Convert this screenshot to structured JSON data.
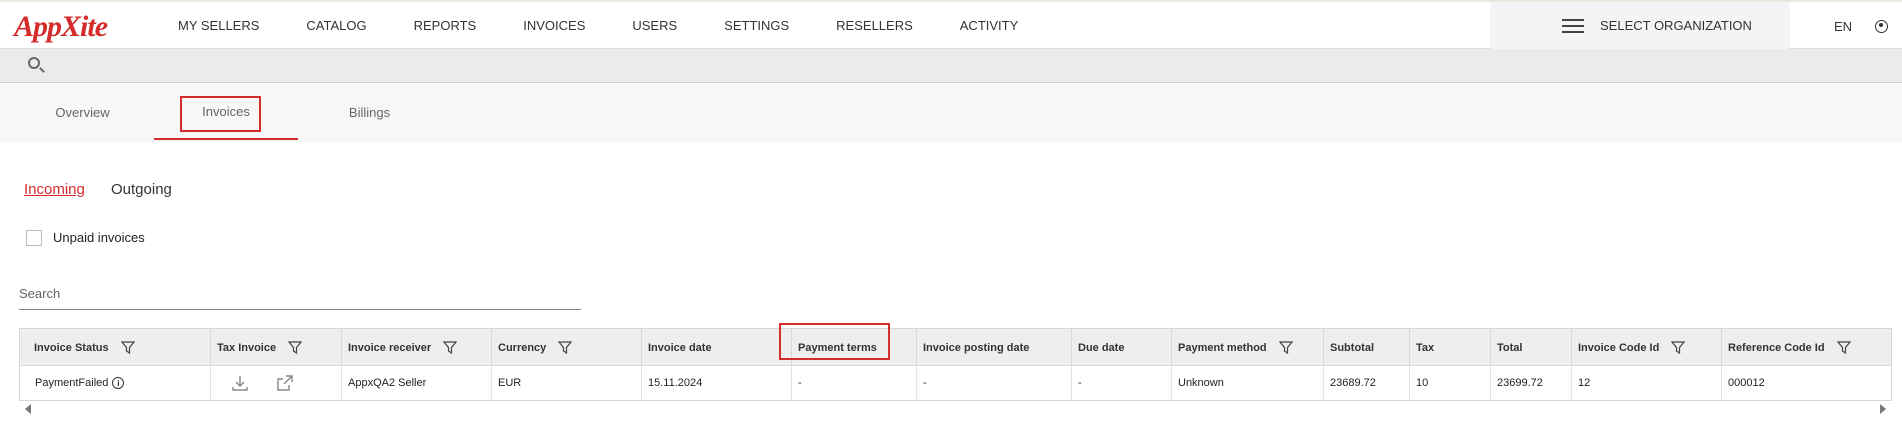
{
  "brand": {
    "logo": "AppXite",
    "accent": "#d42b2b"
  },
  "nav": [
    "MY SELLERS",
    "CATALOG",
    "REPORTS",
    "INVOICES",
    "USERS",
    "SETTINGS",
    "RESELLERS",
    "ACTIVITY"
  ],
  "org": {
    "label": "SELECT ORGANIZATION",
    "icon": "hamburger-icon"
  },
  "lang": "EN",
  "tabs": [
    {
      "label": "Overview",
      "active": false
    },
    {
      "label": "Invoices",
      "active": true
    },
    {
      "label": "Billings",
      "active": false
    }
  ],
  "subtabs": {
    "incoming": "Incoming",
    "outgoing": "Outgoing"
  },
  "filters": {
    "unpaid_label": "Unpaid invoices",
    "unpaid_checked": false
  },
  "search": {
    "placeholder": "Search"
  },
  "table": {
    "columns": [
      "Invoice Status",
      "Tax Invoice",
      "Invoice receiver",
      "Currency",
      "Invoice date",
      "Payment terms",
      "Invoice posting date",
      "Due date",
      "Payment method",
      "Subtotal",
      "Tax",
      "Total",
      "Invoice Code Id",
      "Reference Code Id"
    ],
    "rows": [
      {
        "status": "PaymentFailed",
        "receiver": "AppxQA2 Seller",
        "currency": "EUR",
        "invoice_date": "15.11.2024",
        "payment_terms": "-",
        "posting_date": "-",
        "due_date": "-",
        "payment_method": "Unknown",
        "subtotal": "23689.72",
        "tax": "10",
        "total": "23699.72",
        "invoice_code_id": "12",
        "reference_code_id": "000012"
      }
    ]
  }
}
